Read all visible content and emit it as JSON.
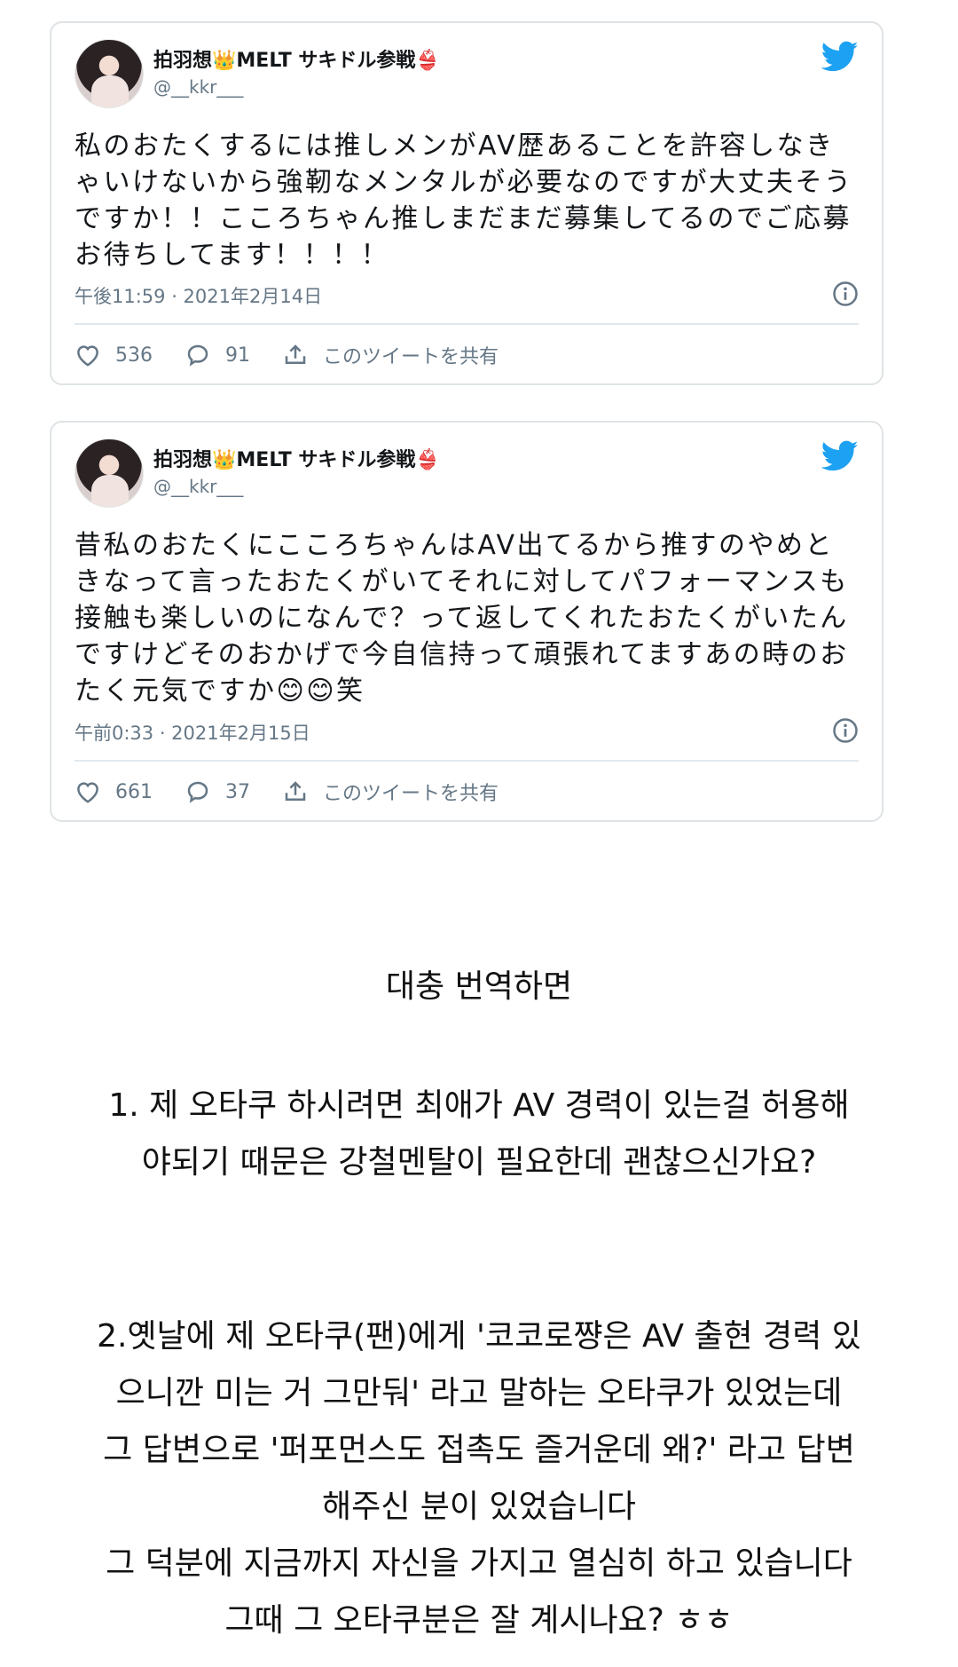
{
  "tweets": [
    {
      "display_name": "拍羽想👑MELT サキドル参戦👙",
      "handle": "@__kkr___",
      "text": "私のおたくするには推しメンがAV歴あることを許容しなきゃいけないから強靭なメンタルが必要なのですが大丈夫そうですか！！こころちゃん推しまだまだ募集してるのでご応募お待ちしてます！！！！",
      "timestamp": "午後11:59 · 2021年2月14日",
      "likes": "536",
      "replies": "91",
      "share_label": "このツイートを共有"
    },
    {
      "display_name": "拍羽想👑MELT サキドル参戦👙",
      "handle": "@__kkr___",
      "text": "昔私のおたくにこころちゃんはAV出てるから推すのやめときなって言ったおたくがいてそれに対してパフォーマンスも接触も楽しいのになんで？って返してくれたおたくがいたんですけどそのおかげで今自信持って頑張れてますあの時のおたく元気ですか😊😊笑",
      "timestamp": "午前0:33 · 2021年2月15日",
      "likes": "661",
      "replies": "37",
      "share_label": "このツイートを共有"
    }
  ],
  "translation": {
    "heading": "대충 번역하면",
    "item1_lines": [
      "1. 제 오타쿠 하시려면 최애가 AV 경력이 있는걸 허용해",
      "야되기 때문은 강철멘탈이 필요한데 괜찮으신가요?"
    ],
    "item2_lines": [
      "2.옛날에 제 오타쿠(팬)에게 '코코로쨩은 AV 출현 경력 있",
      "으니깐 미는 거 그만둬' 라고 말하는 오타쿠가 있었는데",
      "그 답변으로 '퍼포먼스도 접촉도 즐거운데 왜?' 라고 답변",
      "해주신 분이 있었습니다",
      "그 덕분에 지금까지 자신을 가지고 열심히 하고 있습니다",
      "그때 그 오타쿠분은 잘 계시나요? ㅎㅎ"
    ]
  },
  "colors": {
    "twitter_blue": "#1da1f2",
    "meta_gray": "#657786",
    "border": "#dfe3e6"
  },
  "icons": [
    "twitter-bird-icon",
    "info-icon",
    "heart-icon",
    "reply-icon",
    "share-icon"
  ]
}
